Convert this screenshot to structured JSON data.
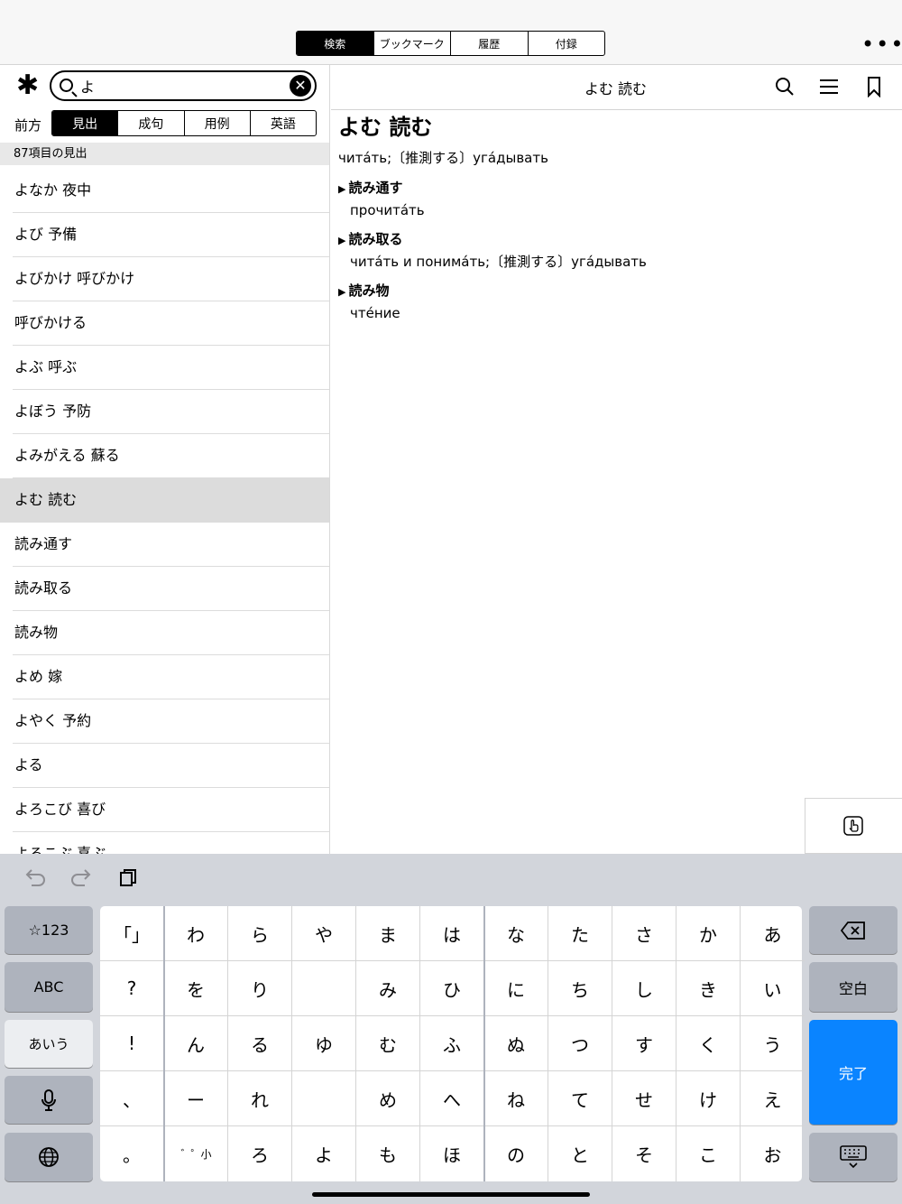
{
  "tabs": [
    "検索",
    "ブックマーク",
    "履歴",
    "付録"
  ],
  "search": {
    "value": "よ"
  },
  "modes": {
    "label": "前方",
    "items": [
      "見出",
      "成句",
      "用例",
      "英語"
    ]
  },
  "result_count": "87項目の見出",
  "list": [
    "よなか 夜中",
    "よび 予備",
    "よびかけ 呼びかけ",
    "呼びかける",
    "よぶ 呼ぶ",
    "よぼう 予防",
    "よみがえる 蘇る",
    "よむ 読む",
    "読み通す",
    "読み取る",
    "読み物",
    "よめ 嫁",
    "よやく 予約",
    "よる",
    "よろこび 喜び",
    "よろこぶ 喜ぶ"
  ],
  "entry": {
    "nav_title": "よむ 読む",
    "headword": "よむ  読む",
    "translation": "читáть;〔推測する〕угáдывать",
    "subentries": [
      {
        "head": "読み通す",
        "text": "прочитáть"
      },
      {
        "head": "読み取る",
        "text": "читáть и понимáть;〔推測する〕угáдывать"
      },
      {
        "head": "読み物",
        "text": "чтéние"
      }
    ]
  },
  "keyboard": {
    "left": [
      "☆123",
      "ABC",
      "あいう"
    ],
    "right": [
      "空白",
      "完了"
    ],
    "rows": [
      [
        "「」",
        "わ",
        "ら",
        "や",
        "ま",
        "は",
        "な",
        "た",
        "さ",
        "か",
        "あ"
      ],
      [
        "?",
        "を",
        "り",
        "",
        "み",
        "ひ",
        "に",
        "ち",
        "し",
        "き",
        "い"
      ],
      [
        "!",
        "ん",
        "る",
        "ゆ",
        "む",
        "ふ",
        "ぬ",
        "つ",
        "す",
        "く",
        "う"
      ],
      [
        "、",
        "ー",
        "れ",
        "",
        "め",
        "へ",
        "ね",
        "て",
        "せ",
        "け",
        "え"
      ],
      [
        "。",
        "゛゜小",
        "ろ",
        "よ",
        "も",
        "ほ",
        "の",
        "と",
        "そ",
        "こ",
        "お"
      ]
    ]
  }
}
